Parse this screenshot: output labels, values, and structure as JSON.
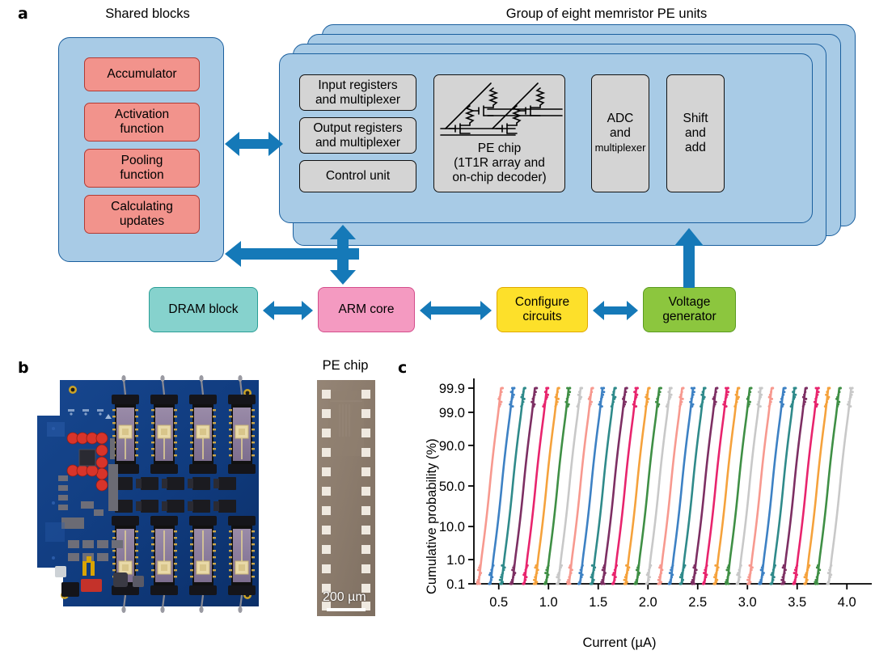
{
  "panels": {
    "a": {
      "letter": "a"
    },
    "b": {
      "letter": "b"
    },
    "c": {
      "letter": "c"
    }
  },
  "panel_a": {
    "shared_title": "Shared blocks",
    "group_title": "Group of eight memristor PE units",
    "shared_blocks": [
      "Accumulator",
      "Activation\nfunction",
      "Pooling\nfunction",
      "Calculating\nupdates"
    ],
    "shared_blocks_display": [
      {
        "l1": "Accumulator",
        "l2": ""
      },
      {
        "l1": "Activation",
        "l2": "function"
      },
      {
        "l1": "Pooling",
        "l2": "function"
      },
      {
        "l1": "Calculating",
        "l2": "updates"
      }
    ],
    "pe_blocks": {
      "input_registers": {
        "l1": "Input registers",
        "l2": "and multiplexer"
      },
      "output_registers": {
        "l1": "Output registers",
        "l2": "and multiplexer"
      },
      "control_unit": {
        "l1": "Control unit",
        "l2": ""
      },
      "pe_chip": {
        "l1": "PE chip",
        "l2": "(1T1R array and",
        "l3": "on-chip decoder)"
      },
      "adc": {
        "l1": "ADC",
        "l2": "and",
        "l3": "multiplexer"
      },
      "shift_add": {
        "l1": "Shift",
        "l2": "and",
        "l3": "add"
      }
    },
    "bottom_blocks": [
      {
        "label": "DRAM block",
        "l1": "DRAM block",
        "l2": "",
        "color": "#86d2cd",
        "name": "dram-block"
      },
      {
        "label": "ARM core",
        "l1": "ARM core",
        "l2": "",
        "color": "#f49ac1",
        "name": "arm-core"
      },
      {
        "label": "Configure circuits",
        "l1": "Configure",
        "l2": "circuits",
        "color": "#fde02a",
        "name": "configure-circuits"
      },
      {
        "label": "Voltage generator",
        "l1": "Voltage",
        "l2": "generator",
        "color": "#8cc63e",
        "name": "voltage-generator"
      }
    ],
    "arrow_color": "#1579b8",
    "card_fill": "#a8cbe6",
    "card_stroke": "#1a5f9e",
    "red_fill": "#f2938c",
    "gray_fill": "#d4d4d4"
  },
  "panel_b": {
    "pe_chip_title": "PE chip",
    "scale_bar_label": "200 µm",
    "pcb_color": "#11408c",
    "chip_color": "#8c7c6d"
  },
  "chart_data": {
    "type": "line",
    "title": "",
    "xlabel": "Current (µA)",
    "ylabel": "Cumulative probability (%)",
    "xlim": [
      0.25,
      4.25
    ],
    "ylim_probability": [
      0.1,
      99.9
    ],
    "x_ticks": [
      0.5,
      1.0,
      1.5,
      2.0,
      2.5,
      3.0,
      3.5,
      4.0
    ],
    "x_tick_labels": [
      "0.5",
      "1.0",
      "1.5",
      "2.0",
      "2.5",
      "3.0",
      "3.5",
      "4.0"
    ],
    "y_ticks": [
      99.9,
      99.0,
      90.0,
      50.0,
      10.0,
      1.0,
      0.1
    ],
    "y_tick_labels": [
      "99.9",
      "99.0",
      "90.0",
      "50.0",
      "10.0",
      "1.0",
      "0.1"
    ],
    "grid": false,
    "legend": "none",
    "series_count": 32,
    "palette": [
      "#f7998f",
      "#3d81c4",
      "#2f8a8a",
      "#7d2f63",
      "#e8246d",
      "#f5a23c",
      "#3f8f45",
      "#c8c8c8"
    ],
    "description": "32 normal-probability (cumulative distribution) curves of memristor conductance states, evenly spaced in current from ~0.4 to ~4.0 microamps",
    "series": [
      {
        "name": "state-1",
        "median": 0.41,
        "sigma": 0.03,
        "color": "#f7998f"
      },
      {
        "name": "state-2",
        "median": 0.53,
        "sigma": 0.03,
        "color": "#3d81c4"
      },
      {
        "name": "state-3",
        "median": 0.64,
        "sigma": 0.03,
        "color": "#2f8a8a"
      },
      {
        "name": "state-4",
        "median": 0.75,
        "sigma": 0.03,
        "color": "#7d2f63"
      },
      {
        "name": "state-5",
        "median": 0.87,
        "sigma": 0.03,
        "color": "#e8246d"
      },
      {
        "name": "state-6",
        "median": 0.98,
        "sigma": 0.03,
        "color": "#f5a23c"
      },
      {
        "name": "state-7",
        "median": 1.09,
        "sigma": 0.03,
        "color": "#3f8f45"
      },
      {
        "name": "state-8",
        "median": 1.21,
        "sigma": 0.03,
        "color": "#c8c8c8"
      },
      {
        "name": "state-9",
        "median": 1.32,
        "sigma": 0.03,
        "color": "#f7998f"
      },
      {
        "name": "state-10",
        "median": 1.43,
        "sigma": 0.03,
        "color": "#3d81c4"
      },
      {
        "name": "state-11",
        "median": 1.55,
        "sigma": 0.03,
        "color": "#2f8a8a"
      },
      {
        "name": "state-12",
        "median": 1.66,
        "sigma": 0.03,
        "color": "#7d2f63"
      },
      {
        "name": "state-13",
        "median": 1.77,
        "sigma": 0.03,
        "color": "#e8246d"
      },
      {
        "name": "state-14",
        "median": 1.89,
        "sigma": 0.03,
        "color": "#f5a23c"
      },
      {
        "name": "state-15",
        "median": 2.0,
        "sigma": 0.03,
        "color": "#3f8f45"
      },
      {
        "name": "state-16",
        "median": 2.11,
        "sigma": 0.03,
        "color": "#c8c8c8"
      },
      {
        "name": "state-17",
        "median": 2.23,
        "sigma": 0.03,
        "color": "#f7998f"
      },
      {
        "name": "state-18",
        "median": 2.34,
        "sigma": 0.03,
        "color": "#3d81c4"
      },
      {
        "name": "state-19",
        "median": 2.45,
        "sigma": 0.03,
        "color": "#2f8a8a"
      },
      {
        "name": "state-20",
        "median": 2.57,
        "sigma": 0.03,
        "color": "#7d2f63"
      },
      {
        "name": "state-21",
        "median": 2.68,
        "sigma": 0.03,
        "color": "#e8246d"
      },
      {
        "name": "state-22",
        "median": 2.79,
        "sigma": 0.03,
        "color": "#f5a23c"
      },
      {
        "name": "state-23",
        "median": 2.91,
        "sigma": 0.03,
        "color": "#3f8f45"
      },
      {
        "name": "state-24",
        "median": 3.02,
        "sigma": 0.03,
        "color": "#c8c8c8"
      },
      {
        "name": "state-25",
        "median": 3.13,
        "sigma": 0.03,
        "color": "#f7998f"
      },
      {
        "name": "state-26",
        "median": 3.25,
        "sigma": 0.03,
        "color": "#3d81c4"
      },
      {
        "name": "state-27",
        "median": 3.36,
        "sigma": 0.03,
        "color": "#2f8a8a"
      },
      {
        "name": "state-28",
        "median": 3.47,
        "sigma": 0.03,
        "color": "#7d2f63"
      },
      {
        "name": "state-29",
        "median": 3.59,
        "sigma": 0.03,
        "color": "#e8246d"
      },
      {
        "name": "state-30",
        "median": 3.7,
        "sigma": 0.03,
        "color": "#f5a23c"
      },
      {
        "name": "state-31",
        "median": 3.81,
        "sigma": 0.03,
        "color": "#3f8f45"
      },
      {
        "name": "state-32",
        "median": 3.93,
        "sigma": 0.03,
        "color": "#c8c8c8"
      }
    ]
  }
}
